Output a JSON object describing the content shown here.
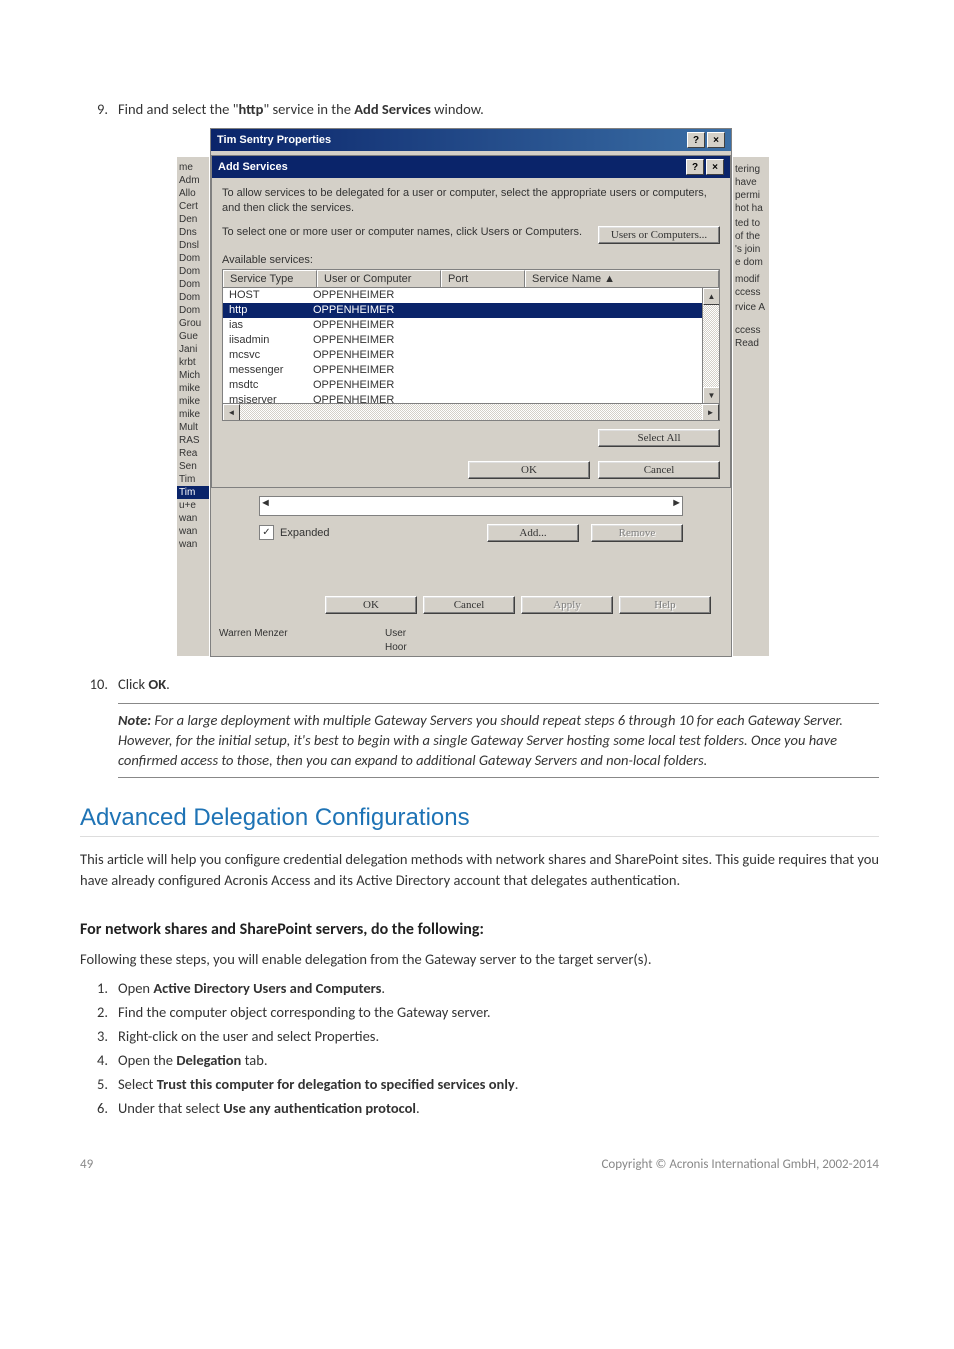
{
  "steps": {
    "s9_num": "9.",
    "s9_text_pre": "Find and select the \"",
    "s9_text_bold": "http",
    "s9_text_mid": "\" service in the ",
    "s9_text_bold2": "Add Services",
    "s9_text_post": " window.",
    "s10_num": "10.",
    "s10_text_pre": "Click ",
    "s10_text_bold": "OK",
    "s10_text_post": "."
  },
  "note": {
    "label": "Note:",
    "text": " For a large deployment with multiple Gateway Servers you should repeat steps 6 through 10 for each Gateway Server. However, for the initial setup, it's best to begin with a single Gateway Server hosting some local test folders. Once you have confirmed access to those, then you can expand to additional Gateway Servers and non-local folders."
  },
  "section_title": "Advanced Delegation Configurations",
  "section_intro": "This article will help you configure credential delegation methods with network shares and SharePoint sites. This guide requires that you have already configured Acronis Access and its Active Directory account that delegates authentication.",
  "subhead": "For network shares and SharePoint servers, do the following:",
  "subhead_intro": "Following these steps, you will enable delegation from the Gateway server to the target server(s).",
  "ol": [
    {
      "n": "1.",
      "pre": "Open ",
      "b": "Active Directory Users and Computers",
      "post": "."
    },
    {
      "n": "2.",
      "pre": "Find the computer object corresponding to the Gateway server.",
      "b": "",
      "post": ""
    },
    {
      "n": "3.",
      "pre": "Right-click on the user and select Properties.",
      "b": "",
      "post": ""
    },
    {
      "n": "4.",
      "pre": "Open the ",
      "b": "Delegation",
      "post": " tab."
    },
    {
      "n": "5.",
      "pre": "Select ",
      "b": "Trust this computer for delegation to specified services only",
      "post": "."
    },
    {
      "n": "6.",
      "pre": "Under that select ",
      "b": "Use any authentication protocol",
      "post": "."
    }
  ],
  "footer": {
    "page": "49",
    "copyright": "Copyright © Acronis International GmbH, 2002-2014"
  },
  "dlg": {
    "outer_title": "Tim Sentry Properties",
    "inner_title": "Add Services",
    "info": "To allow services to be delegated for a user or computer, select the appropriate users or computers, and then click the services.",
    "select_prompt": "To select one or more user or computer names, click Users or Computers.",
    "btn_users": "Users or Computers...",
    "avail": "Available services:",
    "cols": {
      "st": "Service Type",
      "uc": "User or Computer",
      "pt": "Port",
      "sn": "Service Name"
    },
    "rows": [
      {
        "st": "HOST",
        "uc": "OPPENHEIMER"
      },
      {
        "st": "http",
        "uc": "OPPENHEIMER",
        "sel": true
      },
      {
        "st": "ias",
        "uc": "OPPENHEIMER"
      },
      {
        "st": "iisadmin",
        "uc": "OPPENHEIMER"
      },
      {
        "st": "mcsvc",
        "uc": "OPPENHEIMER"
      },
      {
        "st": "messenger",
        "uc": "OPPENHEIMER"
      },
      {
        "st": "msdtc",
        "uc": "OPPENHEIMER"
      },
      {
        "st": "msiserver",
        "uc": "OPPENHEIMER"
      }
    ],
    "btn_select_all": "Select All",
    "btn_ok": "OK",
    "btn_cancel": "Cancel",
    "chk_expanded": "Expanded",
    "btn_add": "Add...",
    "btn_remove": "Remove",
    "btn_apply": "Apply",
    "btn_help": "Help",
    "below_user": "Warren Menzer",
    "below_type": "User",
    "below_blank": "Hoor",
    "left_strip": [
      "me",
      "Adm",
      "Allo",
      "Cert",
      "Den",
      "Dns",
      "Dnsl",
      "Dom",
      "Dom",
      "Dom",
      "Dom",
      "Dom",
      "Grou",
      "Gue",
      "Jani",
      "krbt",
      "Mich",
      "mike",
      "mike",
      "mike",
      "Mult",
      "RAS",
      "Rea",
      "Sen",
      "Tim",
      "Tim",
      "u+e",
      "wan",
      "wan",
      "wan"
    ],
    "left_sel_index": 25,
    "right_strip": [
      "",
      "tering",
      "have",
      "permi",
      "hot ha",
      "",
      "ted to",
      "of the",
      "'s join",
      "e dom",
      "",
      "",
      "modif",
      "ccess",
      "",
      "rvice A",
      "",
      "",
      "",
      "",
      "",
      "ccess",
      "Read",
      "",
      "",
      "",
      "",
      "",
      "",
      ""
    ]
  }
}
